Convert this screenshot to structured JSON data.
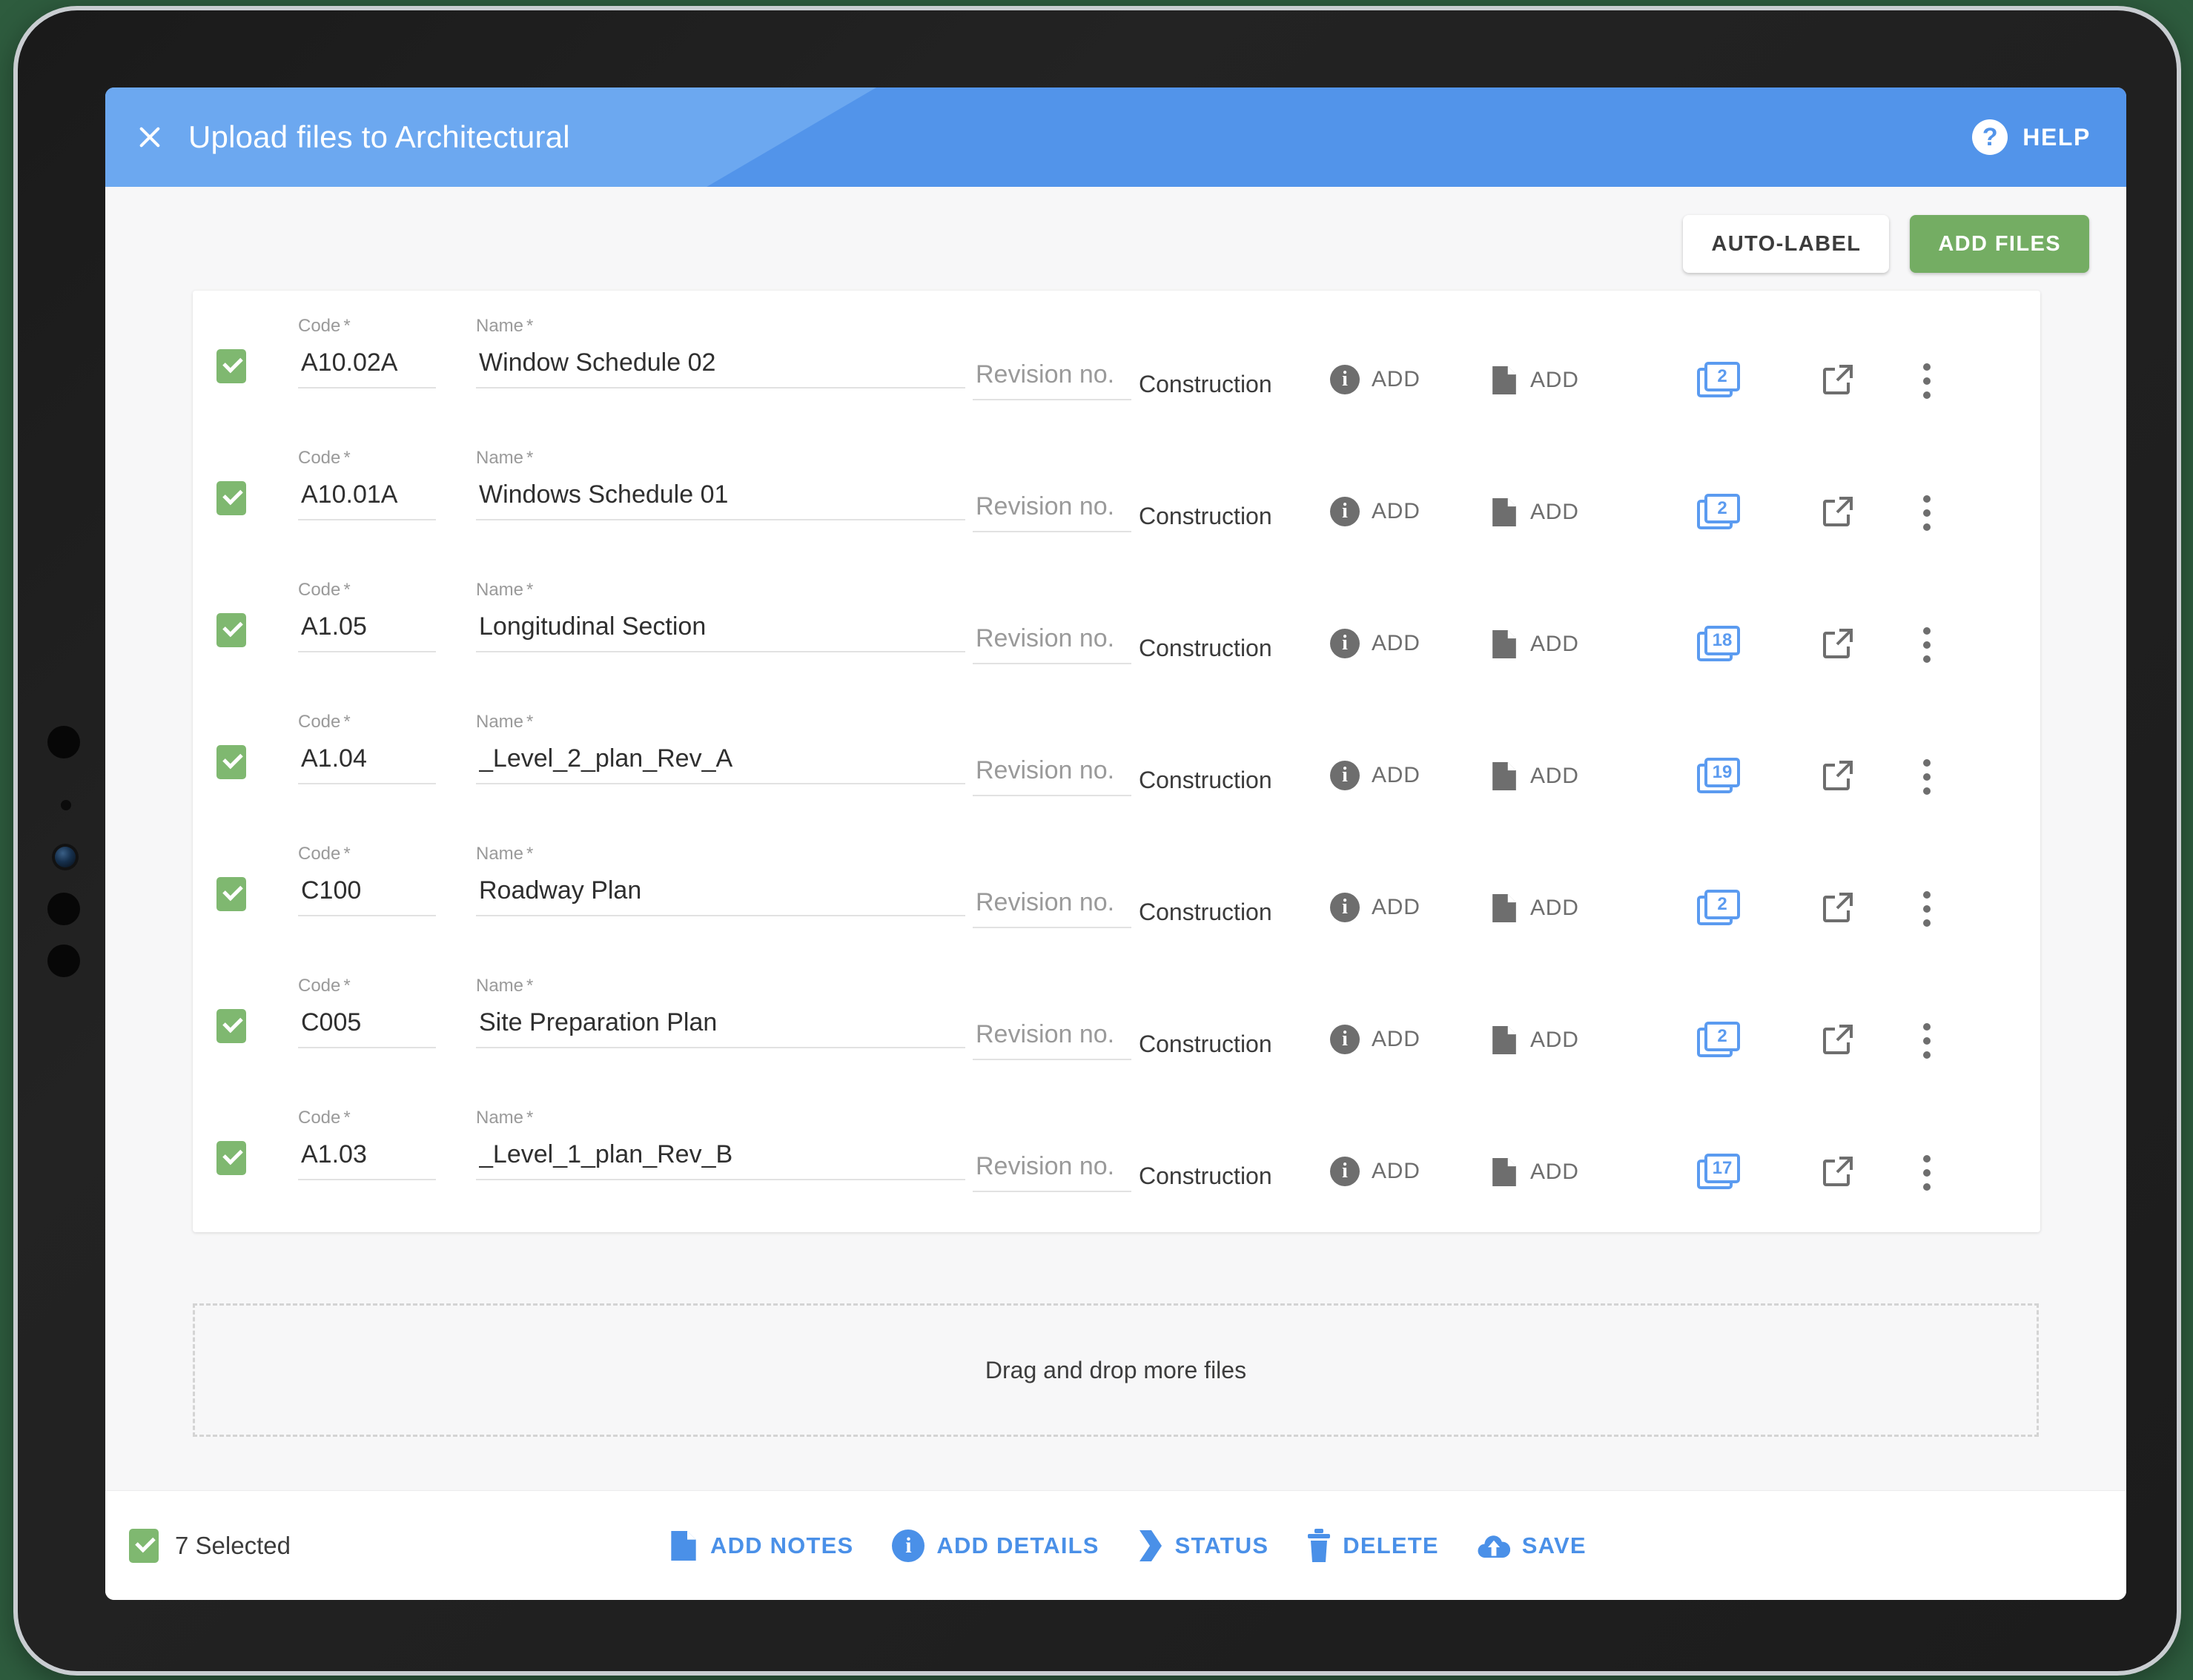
{
  "header": {
    "title": "Upload files to Architectural",
    "close_icon": "close-icon",
    "help_label": "HELP",
    "help_icon": "help-circle-icon",
    "bg_left": "#6ca8f0",
    "bg_right": "#5294ea"
  },
  "toolbar": {
    "auto_label_button": "AUTO-LABEL",
    "add_files_button": "ADD FILES",
    "add_files_color": "#74ad63"
  },
  "table": {
    "labels": {
      "code": "Code",
      "name": "Name",
      "required_mark": "*",
      "revision_placeholder": "Revision no.",
      "add_action": "ADD"
    },
    "rows": [
      {
        "selected": true,
        "code": "A10.02A",
        "name": "Window Schedule 02",
        "revision": "",
        "status": "Construction",
        "details_action": "ADD",
        "notes_action": "ADD",
        "pages": "2"
      },
      {
        "selected": true,
        "code": "A10.01A",
        "name": "Windows Schedule 01",
        "revision": "",
        "status": "Construction",
        "details_action": "ADD",
        "notes_action": "ADD",
        "pages": "2"
      },
      {
        "selected": true,
        "code": "A1.05",
        "name": "Longitudinal Section",
        "revision": "",
        "status": "Construction",
        "details_action": "ADD",
        "notes_action": "ADD",
        "pages": "18"
      },
      {
        "selected": true,
        "code": "A1.04",
        "name": "_Level_2_plan_Rev_A",
        "revision": "",
        "status": "Construction",
        "details_action": "ADD",
        "notes_action": "ADD",
        "pages": "19"
      },
      {
        "selected": true,
        "code": "C100",
        "name": "Roadway Plan",
        "revision": "",
        "status": "Construction",
        "details_action": "ADD",
        "notes_action": "ADD",
        "pages": "2"
      },
      {
        "selected": true,
        "code": "C005",
        "name": "Site Preparation Plan",
        "revision": "",
        "status": "Construction",
        "details_action": "ADD",
        "notes_action": "ADD",
        "pages": "2"
      },
      {
        "selected": true,
        "code": "A1.03",
        "name": "_Level_1_plan_Rev_B",
        "revision": "",
        "status": "Construction",
        "details_action": "ADD",
        "notes_action": "ADD",
        "pages": "17"
      }
    ]
  },
  "dropzone": {
    "text": "Drag and drop more files"
  },
  "actionbar": {
    "selected_count_label": "7 Selected",
    "accent_color": "#4a90e8",
    "actions": [
      {
        "icon": "note-icon",
        "label": "ADD NOTES"
      },
      {
        "icon": "info-circle-icon",
        "label": "ADD DETAILS"
      },
      {
        "icon": "status-chevron-icon",
        "label": "STATUS"
      },
      {
        "icon": "trash-icon",
        "label": "DELETE"
      },
      {
        "icon": "cloud-upload-icon",
        "label": "SAVE"
      }
    ]
  }
}
